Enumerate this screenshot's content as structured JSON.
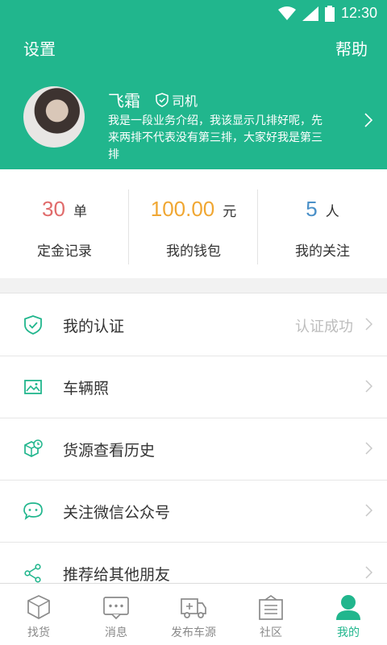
{
  "status_bar": {
    "time": "12:30"
  },
  "header": {
    "left_label": "设置",
    "right_label": "帮助",
    "name": "飞霜",
    "role": "司机",
    "intro": "我是一段业务介绍，我该显示几排好呢，先来两排不代表没有第三排，大家好我是第三排"
  },
  "stats": [
    {
      "value": "30",
      "unit": "单",
      "label": "定金记录",
      "color": "#e06b6b"
    },
    {
      "value": "100.00",
      "unit": "元",
      "label": "我的钱包",
      "color": "#f0a733"
    },
    {
      "value": "5",
      "unit": "人",
      "label": "我的关注",
      "color": "#4a90c8"
    }
  ],
  "menu": [
    {
      "label": "我的认证",
      "value": "认证成功",
      "icon": "shield-check-icon"
    },
    {
      "label": "车辆照",
      "value": "",
      "icon": "image-icon"
    },
    {
      "label": "货源查看历史",
      "value": "",
      "icon": "box-clock-icon"
    },
    {
      "label": "关注微信公众号",
      "value": "",
      "icon": "wechat-icon"
    },
    {
      "label": "推荐给其他朋友",
      "value": "",
      "icon": "share-icon"
    }
  ],
  "tabs": [
    {
      "label": "找货",
      "icon": "cube-icon"
    },
    {
      "label": "消息",
      "icon": "chat-icon"
    },
    {
      "label": "发布车源",
      "icon": "truck-icon"
    },
    {
      "label": "社区",
      "icon": "community-icon"
    },
    {
      "label": "我的",
      "icon": "user-icon"
    }
  ],
  "colors": {
    "primary": "#21b68d",
    "muted_text": "#bdbdbd",
    "tab_inactive": "#8a8a8a"
  }
}
